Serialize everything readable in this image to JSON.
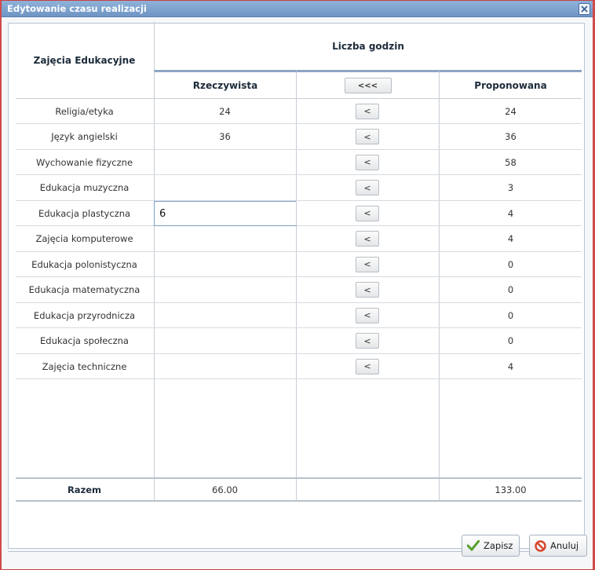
{
  "window": {
    "title": "Edytowanie czasu realizacji"
  },
  "header": {
    "col_subject": "Zajęcia Edukacyjne",
    "group_label": "Liczba godzin",
    "col_actual": "Rzeczywista",
    "copy_all": "<<<",
    "col_proposed": "Proponowana"
  },
  "rows": [
    {
      "subject": "Religia/etyka",
      "actual": "24",
      "proposed": "24"
    },
    {
      "subject": "Język angielski",
      "actual": "36",
      "proposed": "36"
    },
    {
      "subject": "Wychowanie fizyczne",
      "actual": "",
      "proposed": "58"
    },
    {
      "subject": "Edukacja muzyczna",
      "actual": "",
      "proposed": "3"
    },
    {
      "subject": "Edukacja plastyczna",
      "actual": "6",
      "proposed": "4"
    },
    {
      "subject": "Zajęcia komputerowe",
      "actual": "",
      "proposed": "4"
    },
    {
      "subject": "Edukacja polonistyczna",
      "actual": "",
      "proposed": "0"
    },
    {
      "subject": "Edukacja matematyczna",
      "actual": "",
      "proposed": "0"
    },
    {
      "subject": "Edukacja przyrodnicza",
      "actual": "",
      "proposed": "0"
    },
    {
      "subject": "Edukacja społeczna",
      "actual": "",
      "proposed": "0"
    },
    {
      "subject": "Zajęcia techniczne",
      "actual": "",
      "proposed": "4"
    }
  ],
  "copy_one": "<",
  "totals": {
    "label": "Razem",
    "actual": "66.00",
    "proposed": "133.00"
  },
  "buttons": {
    "save": "Zapisz",
    "cancel": "Anuluj"
  },
  "colors": {
    "titlebar": "#7fa3cf",
    "save_icon": "#5aa02c",
    "cancel_icon": "#d9442c"
  }
}
